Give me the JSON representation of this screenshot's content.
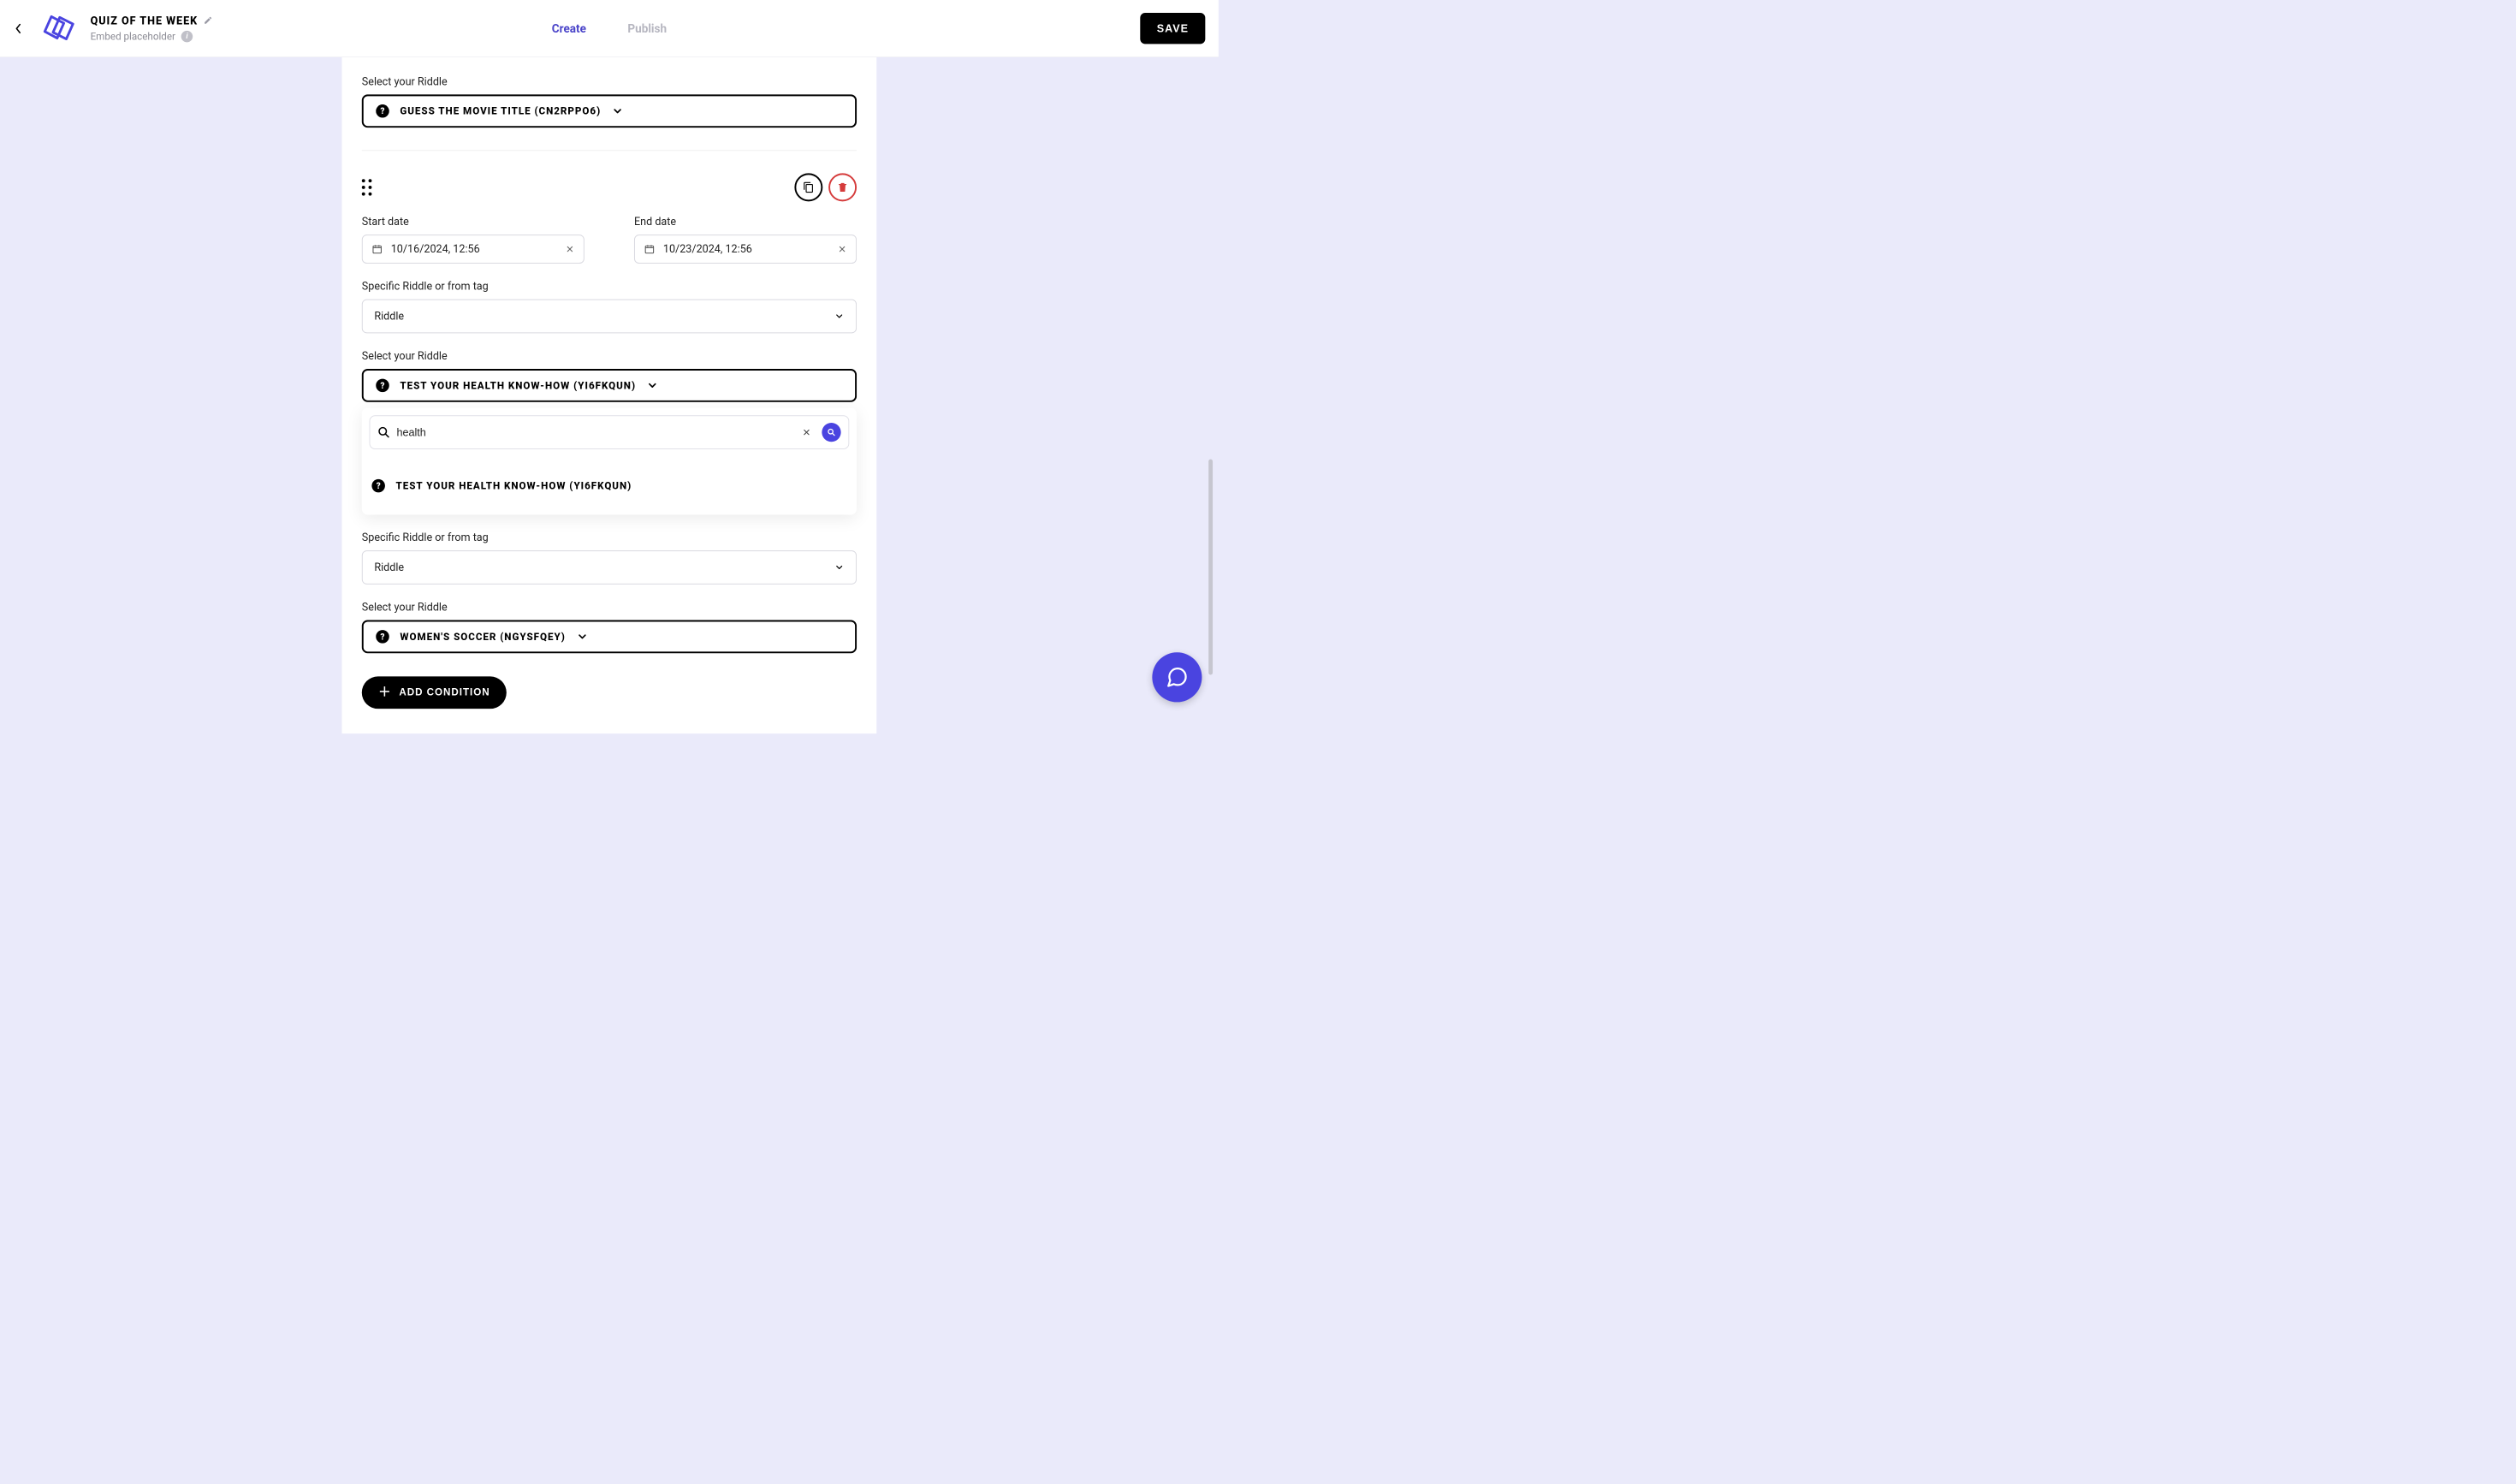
{
  "header": {
    "title": "QUIZ OF THE WEEK",
    "subtitle": "Embed placeholder",
    "save_label": "SAVE",
    "tabs": {
      "create": "Create",
      "publish": "Publish"
    }
  },
  "colors": {
    "accent": "#4a44e0",
    "danger": "#d53b3b"
  },
  "icons": {
    "back": "chevron-left",
    "pencil": "edit",
    "info": "info",
    "question": "?",
    "chevron_down": "chevron-down",
    "calendar": "calendar",
    "clear": "x",
    "copy": "copy",
    "trash": "trash",
    "drag": "drag-handle",
    "search": "search",
    "plus": "plus",
    "chat": "chat"
  },
  "block1": {
    "select_label": "Select your Riddle",
    "riddle_name": "GUESS THE MOVIE TITLE (CN2RPPO6)"
  },
  "block2": {
    "start_label": "Start date",
    "start_value": "10/16/2024, 12:56",
    "end_label": "End date",
    "end_value": "10/23/2024, 12:56",
    "tag_label": "Specific Riddle or from tag",
    "tag_value": "Riddle",
    "select_label": "Select your Riddle",
    "riddle_name": "TEST YOUR HEALTH KNOW-HOW (YI6FKQUN)",
    "search_value": "health",
    "results": [
      {
        "label": "TEST YOUR HEALTH KNOW-HOW (YI6FKQUN)"
      }
    ]
  },
  "block3": {
    "tag_label": "Specific Riddle or from tag",
    "tag_value": "Riddle",
    "select_label": "Select your Riddle",
    "riddle_name": "WOMEN'S SOCCER (NGYSFQEY)"
  },
  "add_condition_label": "ADD CONDITION"
}
